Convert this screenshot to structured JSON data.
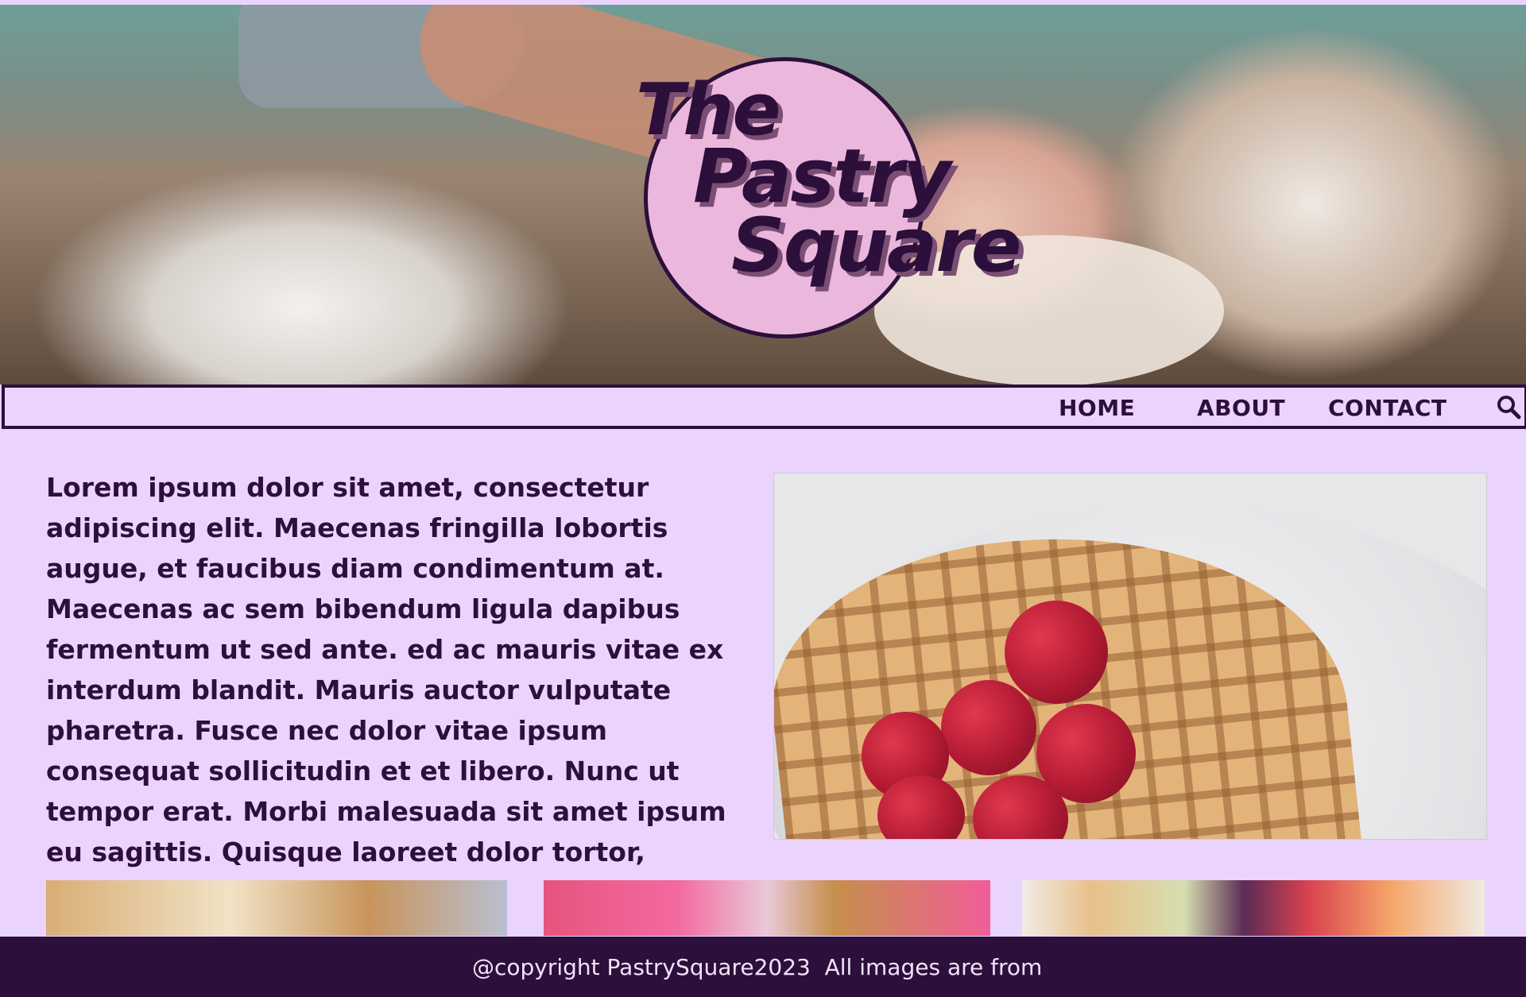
{
  "brand": {
    "logo_line1": "The",
    "logo_line2": "Pastry",
    "logo_line3": "Square",
    "colors": {
      "primary": "#2c0f3b",
      "background": "#ead4fd",
      "logo_fill": "#ebb7dc"
    }
  },
  "nav": {
    "items": [
      {
        "label": "HOME"
      },
      {
        "label": "ABOUT"
      },
      {
        "label": "CONTACT"
      }
    ],
    "search_icon": "search-icon"
  },
  "main": {
    "intro_text": "Lorem ipsum dolor sit amet, consectetur adipiscing elit. Maecenas fringilla lobortis augue, et faucibus diam condimentum at. Maecenas ac sem bibendum ligula dapibus fermentum ut sed ante. ed ac mauris vitae ex interdum blandit. Mauris auctor vulputate pharetra. Fusce nec dolor vitae ipsum consequat sollicitudin et et libero. Nunc ut tempor erat. Morbi malesuada sit amet ipsum eu sagittis. Quisque laoreet dolor tortor, luctus"
  },
  "footer": {
    "text": "@copyright PastrySquare2023  All images are from"
  }
}
